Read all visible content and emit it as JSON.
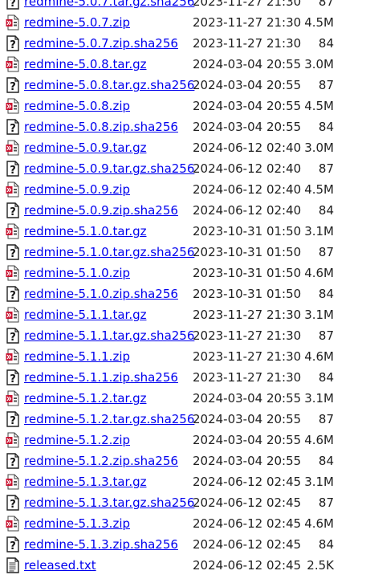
{
  "icon_types": {
    "archive": "archive-icon",
    "unknown": "unknown-file-icon",
    "text": "text-file-icon"
  },
  "files": [
    {
      "name": "redmine-5.0.7.tar.gz.sha256",
      "date": "2023-11-27 21:30",
      "size": "87",
      "icon": "unknown"
    },
    {
      "name": "redmine-5.0.7.zip",
      "date": "2023-11-27 21:30",
      "size": "4.5M",
      "icon": "archive"
    },
    {
      "name": "redmine-5.0.7.zip.sha256",
      "date": "2023-11-27 21:30",
      "size": "84",
      "icon": "unknown"
    },
    {
      "name": "redmine-5.0.8.tar.gz",
      "date": "2024-03-04 20:55",
      "size": "3.0M",
      "icon": "archive"
    },
    {
      "name": "redmine-5.0.8.tar.gz.sha256",
      "date": "2024-03-04 20:55",
      "size": "87",
      "icon": "unknown"
    },
    {
      "name": "redmine-5.0.8.zip",
      "date": "2024-03-04 20:55",
      "size": "4.5M",
      "icon": "archive"
    },
    {
      "name": "redmine-5.0.8.zip.sha256",
      "date": "2024-03-04 20:55",
      "size": "84",
      "icon": "unknown"
    },
    {
      "name": "redmine-5.0.9.tar.gz",
      "date": "2024-06-12 02:40",
      "size": "3.0M",
      "icon": "archive"
    },
    {
      "name": "redmine-5.0.9.tar.gz.sha256",
      "date": "2024-06-12 02:40",
      "size": "87",
      "icon": "unknown"
    },
    {
      "name": "redmine-5.0.9.zip",
      "date": "2024-06-12 02:40",
      "size": "4.5M",
      "icon": "archive"
    },
    {
      "name": "redmine-5.0.9.zip.sha256",
      "date": "2024-06-12 02:40",
      "size": "84",
      "icon": "unknown"
    },
    {
      "name": "redmine-5.1.0.tar.gz",
      "date": "2023-10-31 01:50",
      "size": "3.1M",
      "icon": "archive"
    },
    {
      "name": "redmine-5.1.0.tar.gz.sha256",
      "date": "2023-10-31 01:50",
      "size": "87",
      "icon": "unknown"
    },
    {
      "name": "redmine-5.1.0.zip",
      "date": "2023-10-31 01:50",
      "size": "4.6M",
      "icon": "archive"
    },
    {
      "name": "redmine-5.1.0.zip.sha256",
      "date": "2023-10-31 01:50",
      "size": "84",
      "icon": "unknown"
    },
    {
      "name": "redmine-5.1.1.tar.gz",
      "date": "2023-11-27 21:30",
      "size": "3.1M",
      "icon": "archive"
    },
    {
      "name": "redmine-5.1.1.tar.gz.sha256",
      "date": "2023-11-27 21:30",
      "size": "87",
      "icon": "unknown"
    },
    {
      "name": "redmine-5.1.1.zip",
      "date": "2023-11-27 21:30",
      "size": "4.6M",
      "icon": "archive"
    },
    {
      "name": "redmine-5.1.1.zip.sha256",
      "date": "2023-11-27 21:30",
      "size": "84",
      "icon": "unknown"
    },
    {
      "name": "redmine-5.1.2.tar.gz",
      "date": "2024-03-04 20:55",
      "size": "3.1M",
      "icon": "archive"
    },
    {
      "name": "redmine-5.1.2.tar.gz.sha256",
      "date": "2024-03-04 20:55",
      "size": "87",
      "icon": "unknown"
    },
    {
      "name": "redmine-5.1.2.zip",
      "date": "2024-03-04 20:55",
      "size": "4.6M",
      "icon": "archive"
    },
    {
      "name": "redmine-5.1.2.zip.sha256",
      "date": "2024-03-04 20:55",
      "size": "84",
      "icon": "unknown"
    },
    {
      "name": "redmine-5.1.3.tar.gz",
      "date": "2024-06-12 02:45",
      "size": "3.1M",
      "icon": "archive"
    },
    {
      "name": "redmine-5.1.3.tar.gz.sha256",
      "date": "2024-06-12 02:45",
      "size": "87",
      "icon": "unknown"
    },
    {
      "name": "redmine-5.1.3.zip",
      "date": "2024-06-12 02:45",
      "size": "4.6M",
      "icon": "archive"
    },
    {
      "name": "redmine-5.1.3.zip.sha256",
      "date": "2024-06-12 02:45",
      "size": "84",
      "icon": "unknown"
    },
    {
      "name": "released.txt",
      "date": "2024-06-12 02:45",
      "size": "2.5K",
      "icon": "text"
    }
  ]
}
